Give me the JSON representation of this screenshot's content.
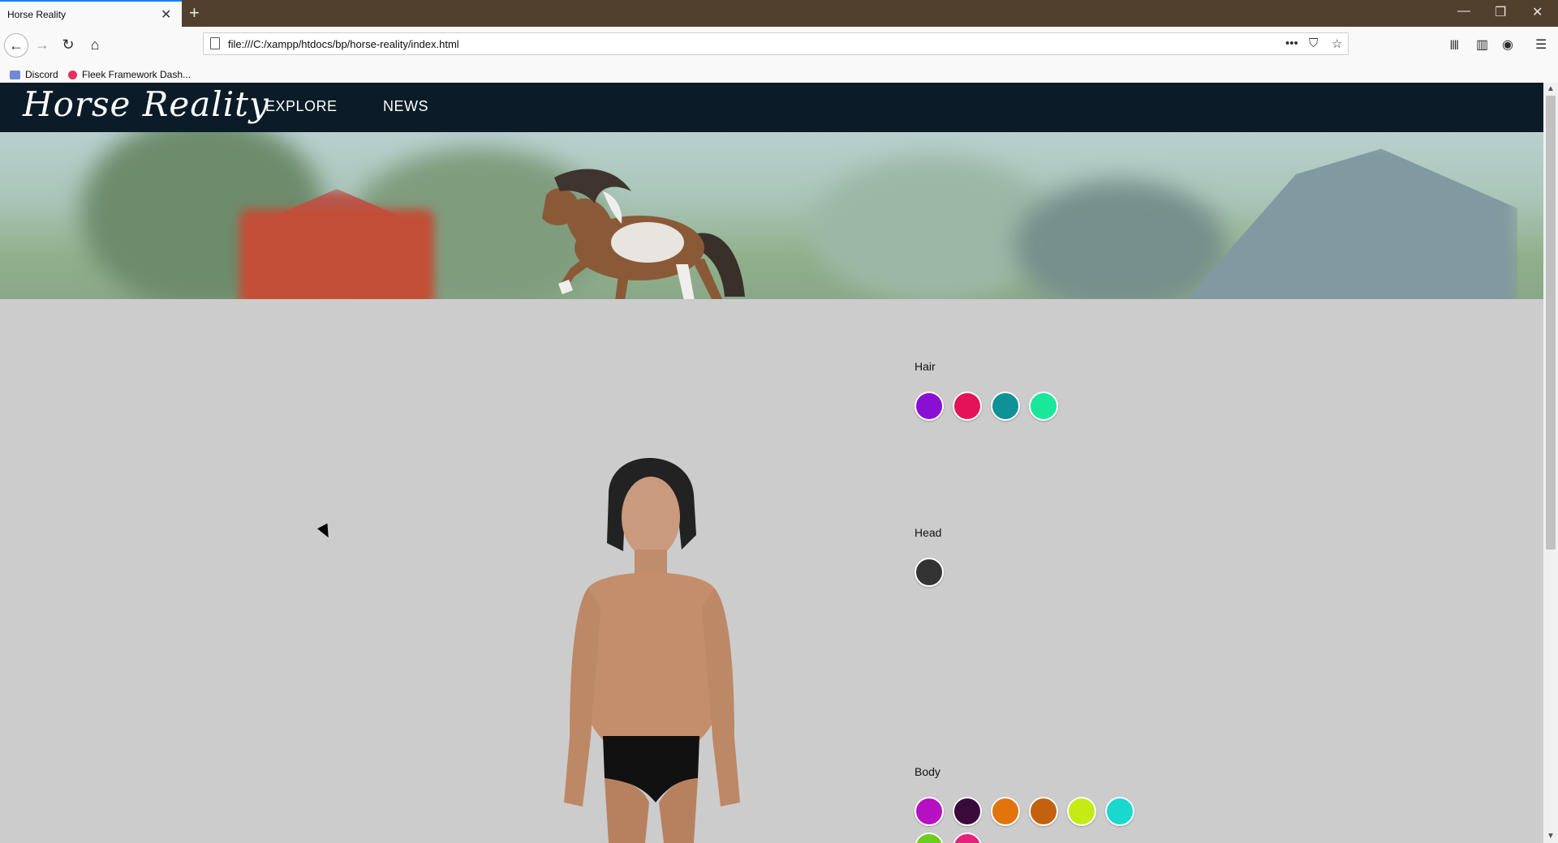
{
  "browser": {
    "tab_title": "Horse Reality",
    "tab_close_icon": "close-icon",
    "new_tab_icon": "plus-icon",
    "url": "file:///C:/xampp/htdocs/bp/horse-reality/index.html",
    "window_controls": [
      "minimize-icon",
      "restore-icon",
      "close-icon"
    ],
    "bookmarks": [
      {
        "label": "Discord",
        "icon": "discord-icon",
        "color": "#7289da"
      },
      {
        "label": "Fleek Framework Dash...",
        "icon": "fleek-icon",
        "color": "#e3325c"
      }
    ]
  },
  "site": {
    "logo": "Horse Reality",
    "menu": [
      "EXPLORE",
      "NEWS"
    ],
    "banner_image": "horse-banner"
  },
  "customizer": {
    "sections": [
      {
        "label": "Hair",
        "colors": [
          "#8a0fd4",
          "#e5125a",
          "#0e9297",
          "#19e89b"
        ]
      },
      {
        "label": "Head",
        "colors": [
          "#333333"
        ]
      },
      {
        "label": "Body",
        "colors": [
          "#b70fc4",
          "#3a0a3a",
          "#e2740b",
          "#c4610f",
          "#c4ec14",
          "#19d9cf",
          "#6ecb1f",
          "#e4217b"
        ]
      }
    ]
  },
  "colors": {
    "nav_bg": "#0b1c28",
    "page_bg": "#cccccc",
    "browser_frame": "#52402e"
  }
}
